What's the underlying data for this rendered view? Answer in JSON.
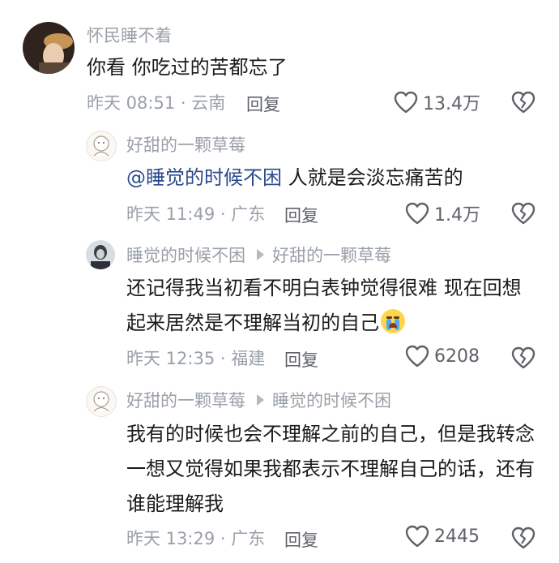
{
  "comments": [
    {
      "author": "怀民睡不着",
      "reply_to": "",
      "mention": "",
      "text": "你看 你吃过的苦都忘了",
      "time_location": "昨天 08:51 · 云南",
      "reply_label": "回复",
      "likes": "13.4万"
    },
    {
      "author": "好甜的一颗草莓",
      "reply_to": "",
      "mention": "@睡觉的时候不困",
      "text": " 人就是会淡忘痛苦的",
      "time_location": "昨天 11:49 · 广东",
      "reply_label": "回复",
      "likes": "1.4万"
    },
    {
      "author": "睡觉的时候不困",
      "reply_to": "好甜的一颗草莓",
      "mention": "",
      "text": "还记得我当初看不明白表钟觉得很难 现在回想起来居然是不理解当初的自己",
      "time_location": "昨天 12:35 · 福建",
      "reply_label": "回复",
      "likes": "6208"
    },
    {
      "author": "好甜的一颗草莓",
      "reply_to": "睡觉的时候不困",
      "mention": "",
      "text": "我有的时候也会不理解之前的自己，但是我转念一想又觉得如果我都表示不理解自己的话，还有谁能理解我",
      "time_location": "昨天 13:29 · 广东",
      "reply_label": "回复",
      "likes": "2445"
    }
  ],
  "icons": {
    "like": "heart-outline-icon",
    "dislike": "broken-heart-icon",
    "emoji": "loudly-crying-face-emoji"
  },
  "colors": {
    "mention": "#2b4a8b",
    "meta": "#9aa0a8",
    "text": "#1b1b1b"
  }
}
